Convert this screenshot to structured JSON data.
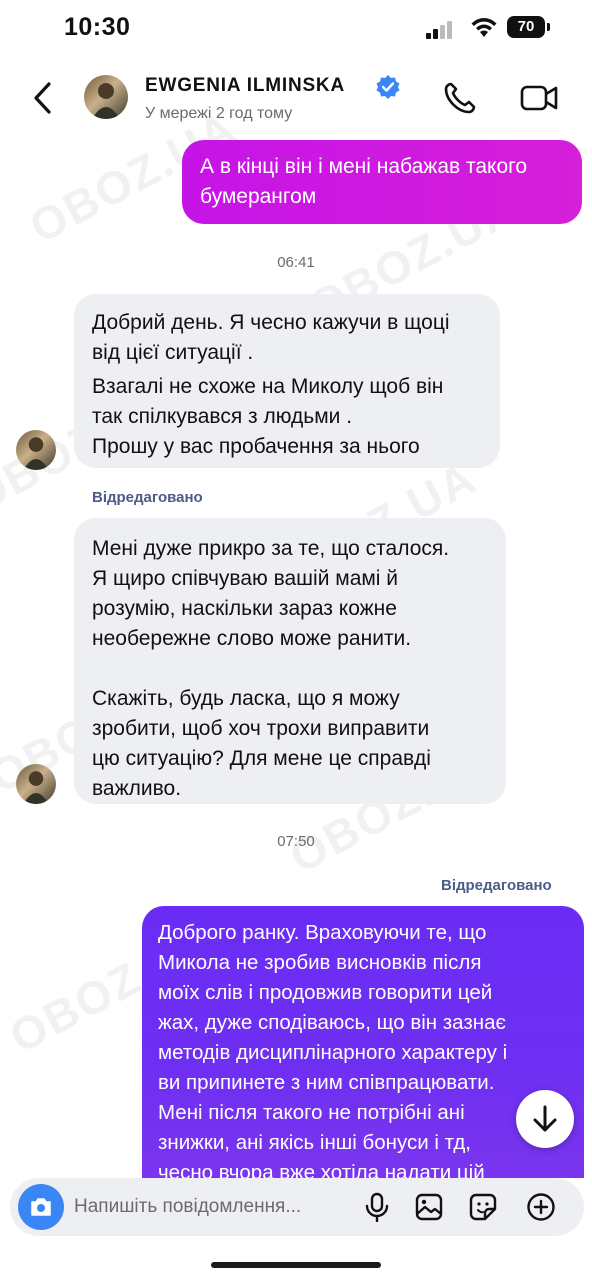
{
  "status_bar": {
    "time": "10:30",
    "battery": "70"
  },
  "header": {
    "contact_name": "EWGENIA  ILMINSKA",
    "presence": "У мережі 2 год тому"
  },
  "messages": [
    {
      "type": "outgoing",
      "text": "А в кінці він і мені набажав такого\nбумерангом"
    },
    {
      "type": "timestamp",
      "text": "06:41"
    },
    {
      "type": "incoming",
      "lines": [
        "Добрий день.  Я чесно кажучи в щоці",
        "від цієї ситуації .",
        "Взагалі  не схоже на Миколу щоб він",
        "так спілкувався з людьми .",
        "Прошу у вас  пробачення за нього"
      ]
    },
    {
      "type": "edited",
      "text": "Відредаговано"
    },
    {
      "type": "incoming",
      "text": "Мені дуже прикро за те, що сталося.\nЯ щиро співчуваю вашій мамі й\nрозумію, наскільки зараз кожне\nнеобережне слово може ранити.\n\nСкажіть, будь ласка, що я можу\nзробити, щоб хоч трохи виправити\nцю ситуацію? Для мене це справді\nважливо."
    },
    {
      "type": "timestamp",
      "text": "07:50"
    },
    {
      "type": "edited",
      "text": "Відредаговано"
    },
    {
      "type": "outgoing",
      "text": "Доброго ранку. Враховуючи те, що\nМикола не зробив висновків після\nмоїх слів і продовжив говорити цей\nжах,  дуже сподіваюсь, що він зазнає\nметодів дисциплінарного характеру і\nви припинете з ним співпрацювати.\nМені після такого не потрібні ані\nзнижки, ані якісь інші бонуси і тд,\nчесно вчора вже хотіла надати цій"
    }
  ],
  "composer": {
    "placeholder": "Напишіть повідомлення..."
  },
  "watermark": "OBOZ.UA",
  "colors": {
    "outgoing_pink": "#c514e6",
    "outgoing_purple": "#6a2cf5",
    "incoming": "#eeeff3",
    "camera": "#3a86f5",
    "verified": "#3a86f5"
  }
}
